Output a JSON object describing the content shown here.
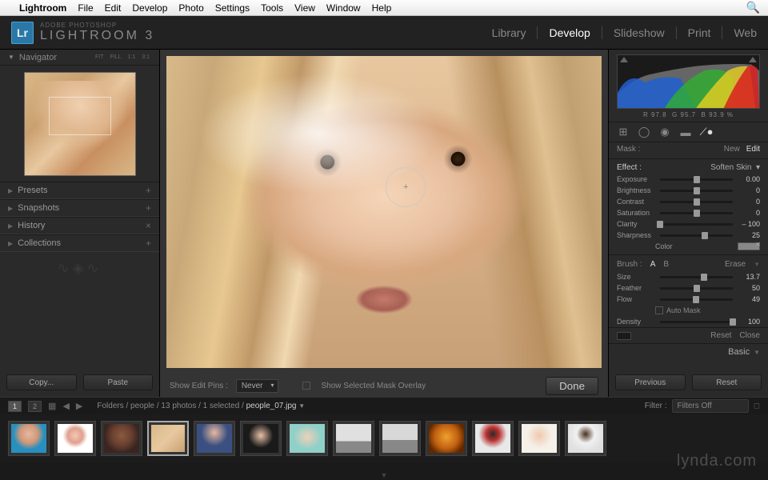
{
  "mac_menu": {
    "app": "Lightroom",
    "items": [
      "File",
      "Edit",
      "Develop",
      "Photo",
      "Settings",
      "Tools",
      "View",
      "Window",
      "Help"
    ]
  },
  "brand": {
    "small": "ADOBE PHOTOSHOP",
    "large": "LIGHTROOM 3"
  },
  "modules": {
    "items": [
      "Library",
      "Develop",
      "Slideshow",
      "Print",
      "Web"
    ],
    "active": "Develop"
  },
  "navigator": {
    "title": "Navigator",
    "opts": [
      "FIT",
      "FILL",
      "1:1",
      "3:1"
    ]
  },
  "left_panels": [
    {
      "label": "Presets",
      "action": "+"
    },
    {
      "label": "Snapshots",
      "action": "+"
    },
    {
      "label": "History",
      "action": "×"
    },
    {
      "label": "Collections",
      "action": "+"
    }
  ],
  "copy_paste": {
    "copy": "Copy...",
    "paste": "Paste"
  },
  "canvas_bar": {
    "pins_label": "Show Edit Pins :",
    "pins_value": "Never",
    "overlay": "Show Selected Mask Overlay",
    "done": "Done"
  },
  "rgb": {
    "r": "R  97.8",
    "g": "G  95.7",
    "b": "B  93.9 %"
  },
  "mask": {
    "label": "Mask :",
    "new": "New",
    "edit": "Edit"
  },
  "effect": {
    "label": "Effect :",
    "value": "Soften Skin"
  },
  "sliders": [
    {
      "name": "Exposure",
      "val": "0.00",
      "pos": 50
    },
    {
      "name": "Brightness",
      "val": "0",
      "pos": 50
    },
    {
      "name": "Contrast",
      "val": "0",
      "pos": 50
    },
    {
      "name": "Saturation",
      "val": "0",
      "pos": 50
    },
    {
      "name": "Clarity",
      "val": "– 100",
      "pos": 0
    },
    {
      "name": "Sharpness",
      "val": "25",
      "pos": 62
    }
  ],
  "color_label": "Color",
  "brush": {
    "label": "Brush :",
    "a": "A",
    "b": "B",
    "erase": "Erase",
    "params": [
      {
        "name": "Size",
        "val": "13.7",
        "pos": 60
      },
      {
        "name": "Feather",
        "val": "50",
        "pos": 50
      },
      {
        "name": "Flow",
        "val": "49",
        "pos": 49
      }
    ],
    "automask": "Auto Mask",
    "density": {
      "name": "Density",
      "val": "100",
      "pos": 100
    }
  },
  "panel_footer": {
    "reset": "Reset",
    "close": "Close"
  },
  "basic_label": "Basic",
  "prev_reset": {
    "prev": "Previous",
    "reset": "Reset"
  },
  "sec": {
    "view1": "1",
    "view2": "2",
    "crumbs_pre": "Folders / people / 13 photos / 1 selected / ",
    "crumbs_file": "people_07.jpg",
    "filter_label": "Filter :",
    "filter_value": "Filters Off"
  },
  "watermark": "lynda.com"
}
